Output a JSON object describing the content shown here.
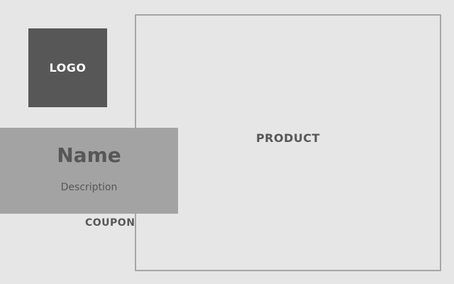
{
  "logo": {
    "label": "LOGO"
  },
  "product": {
    "label": "PRODUCT"
  },
  "info": {
    "name": "Name",
    "description": "Description"
  },
  "coupon": {
    "label": "COUPON"
  },
  "colors": {
    "background": "#e6e6e6",
    "logo_fill": "#575757",
    "info_panel_fill": "#a3a3a3",
    "product_border": "#a6a6a6",
    "text_dark": "#575757",
    "text_light": "#ffffff"
  }
}
